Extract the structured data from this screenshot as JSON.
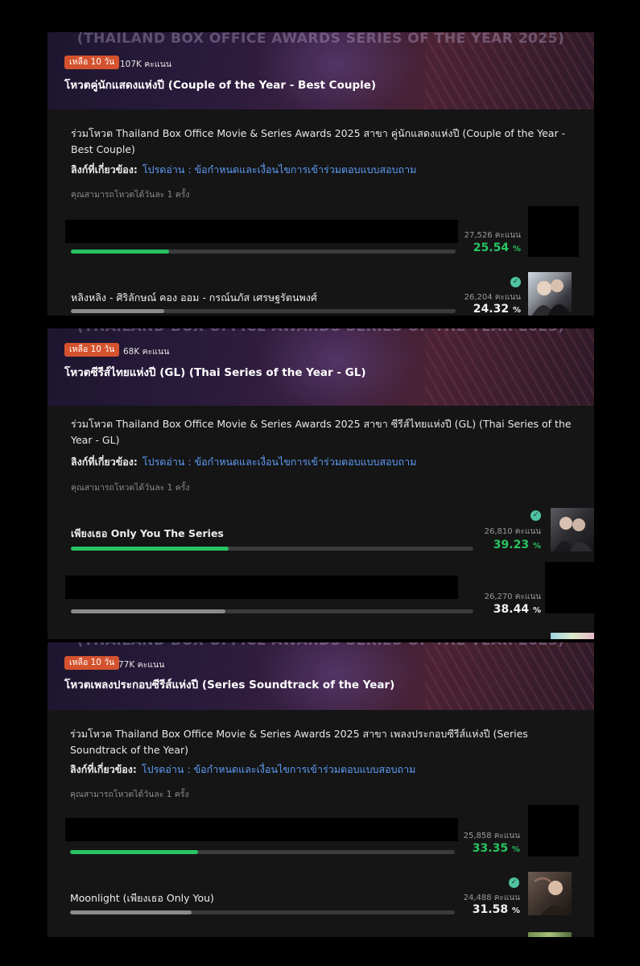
{
  "banner_text": "(THAILAND BOX OFFICE AWARDS SERIES OF THE YEAR 2025)",
  "colors": {
    "accent_green": "#28c462",
    "bar_gray": "#8a8a8a",
    "badge_orange": "#d4532e",
    "link_blue": "#5e9cf5"
  },
  "icons": {
    "winner_badge": "check-circle-icon"
  },
  "polls": [
    {
      "badge": "เหลือ 10 วัน",
      "total_votes": "107K คะแนน",
      "title": "โหวตคู่นักแสดงแห่งปี (Couple of the Year - Best Couple)",
      "description": "ร่วมโหวต Thailand Box Office Movie & Series Awards 2025 สาขา คู่นักแสดงแห่งปี (Couple of the Year - Best Couple)",
      "related_label": "ลิงก์ที่เกี่ยวข้อง:",
      "related_link": "โปรดอ่าน : ข้อกำหนดและเงื่อนไขการเข้าร่วมตอบแบบสอบถาม",
      "vote_note": "คุณสามารถโหวตได้วันละ 1 ครั้ง",
      "candidates": [
        {
          "name": "",
          "votes": "27,526 คะแนน",
          "percent": "25.54",
          "percent_value": 25.54,
          "leader": true
        },
        {
          "name": "หลิงหลิง - ศิริลักษณ์ คอง ออม - กรณ์นภัส เศรษฐรัตนพงศ์",
          "votes": "26,204 คะแนน",
          "percent": "24.32",
          "percent_value": 24.32,
          "leader": false
        }
      ]
    },
    {
      "badge": "เหลือ 10 วัน",
      "total_votes": "68K คะแนน",
      "title": "โหวตซีรีส์ไทยแห่งปี (GL) (Thai Series of the Year - GL)",
      "description": "ร่วมโหวต Thailand Box Office Movie & Series Awards 2025 สาขา ซีรีส์ไทยแห่งปี (GL) (Thai Series of the Year - GL)",
      "related_label": "ลิงก์ที่เกี่ยวข้อง:",
      "related_link": "โปรดอ่าน : ข้อกำหนดและเงื่อนไขการเข้าร่วมตอบแบบสอบถาม",
      "vote_note": "คุณสามารถโหวตได้วันละ 1 ครั้ง",
      "candidates": [
        {
          "name": "เพียงเธอ Only You The Series",
          "votes": "26,810 คะแนน",
          "percent": "39.23",
          "percent_value": 39.23,
          "leader": true
        },
        {
          "name": "",
          "votes": "26,270 คะแนน",
          "percent": "38.44",
          "percent_value": 38.44,
          "leader": false
        }
      ]
    },
    {
      "badge": "เหลือ 10 วัน",
      "total_votes": "77K คะแนน",
      "title": "โหวตเพลงประกอบซีรีส์แห่งปี (Series Soundtrack of the Year)",
      "description": "ร่วมโหวต Thailand Box Office Movie & Series Awards 2025 สาขา เพลงประกอบซีรีส์แห่งปี (Series Soundtrack of the Year)",
      "related_label": "ลิงก์ที่เกี่ยวข้อง:",
      "related_link": "โปรดอ่าน : ข้อกำหนดและเงื่อนไขการเข้าร่วมตอบแบบสอบถาม",
      "vote_note": "คุณสามารถโหวตได้วันละ 1 ครั้ง",
      "candidates": [
        {
          "name": "",
          "votes": "25,858 คะแนน",
          "percent": "33.35",
          "percent_value": 33.35,
          "leader": true
        },
        {
          "name": "Moonlight (เพียงเธอ Only You)",
          "votes": "24,488 คะแนน",
          "percent": "31.58",
          "percent_value": 31.58,
          "leader": false
        }
      ]
    }
  ]
}
